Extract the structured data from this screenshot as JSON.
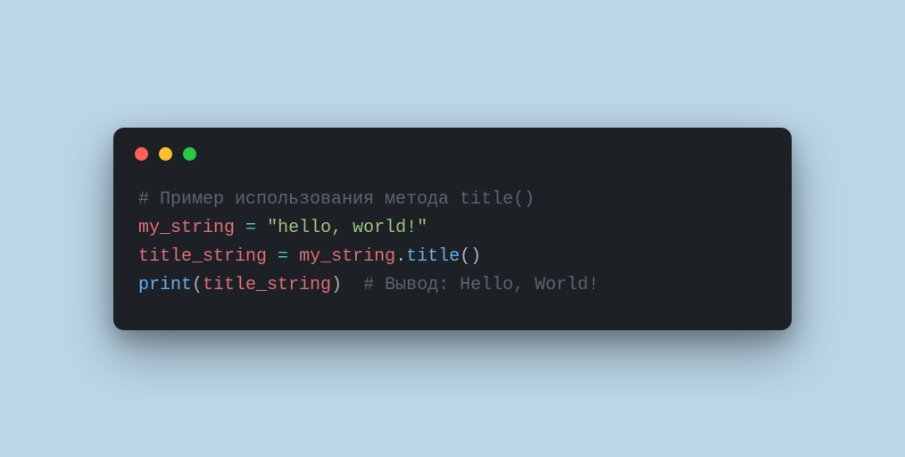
{
  "window": {
    "controls": [
      "red",
      "yellow",
      "green"
    ]
  },
  "code": {
    "line1": {
      "comment": "# Пример использования метода title()"
    },
    "line2": {
      "var": "my_string",
      "sp1": " ",
      "op": "=",
      "sp2": " ",
      "str": "\"hello, world!\""
    },
    "line3": {
      "var1": "title_string",
      "sp1": " ",
      "op": "=",
      "sp2": " ",
      "var2": "my_string",
      "dot": ".",
      "method": "title",
      "paren": "()"
    },
    "line4": {
      "func": "print",
      "lparen": "(",
      "arg": "title_string",
      "rparen": ")",
      "sp": "  ",
      "comment": "# Вывод: Hello, World!"
    }
  }
}
